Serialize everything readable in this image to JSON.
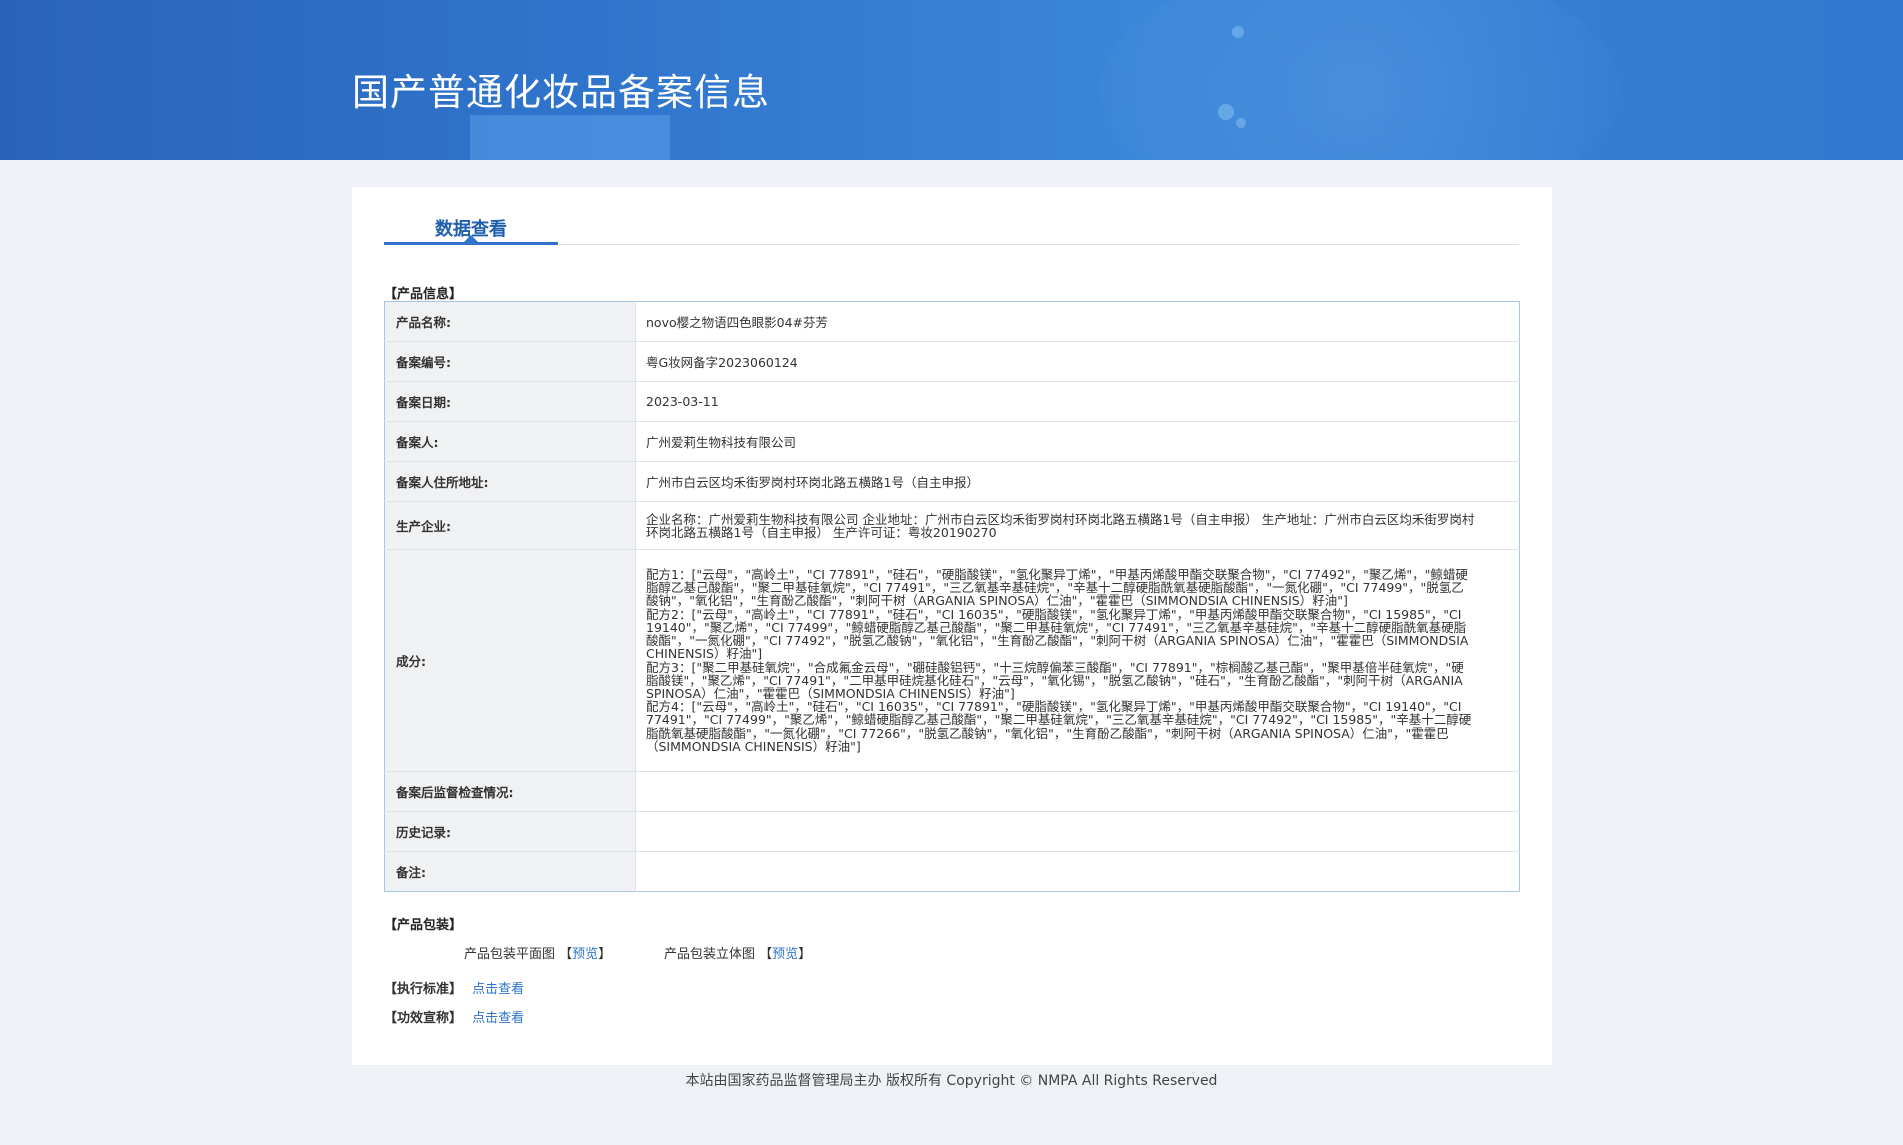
{
  "header": {
    "title": "国产普通化妆品备案信息"
  },
  "tab": {
    "label": "数据查看"
  },
  "sections": {
    "product_info": "【产品信息】",
    "product_package": "【产品包装】",
    "standard": "【执行标准】",
    "efficacy": "【功效宣称】"
  },
  "table": {
    "product_name": {
      "label": "产品名称:",
      "value": "novo樱之物语四色眼影04#芬芳"
    },
    "record_no": {
      "label": "备案编号:",
      "value": "粤G妆网备字2023060124"
    },
    "record_date": {
      "label": "备案日期:",
      "value": "2023-03-11"
    },
    "registrant": {
      "label": "备案人:",
      "value": "广州爱莉生物科技有限公司"
    },
    "registrant_address": {
      "label": "备案人住所地址:",
      "value": "广州市白云区均禾街罗岗村环岗北路五横路1号（自主申报）"
    },
    "manufacturer": {
      "label": "生产企业:",
      "value": "企业名称：广州爱莉生物科技有限公司 企业地址：广州市白云区均禾街罗岗村环岗北路五横路1号（自主申报） 生产地址：广州市白云区均禾街罗岗村环岗北路五横路1号（自主申报） 生产许可证：粤妆20190270"
    },
    "ingredients": {
      "label": "成分:",
      "value": "配方1：[\"云母\"，\"高岭土\"，\"CI 77891\"，\"硅石\"，\"硬脂酸镁\"，\"氢化聚异丁烯\"，\"甲基丙烯酸甲酯交联聚合物\"，\"CI 77492\"，\"聚乙烯\"，\"鲸蜡硬脂醇乙基己酸酯\"，\"聚二甲基硅氧烷\"，\"CI 77491\"，\"三乙氧基辛基硅烷\"，\"辛基十二醇硬脂酰氧基硬脂酸酯\"，\"一氮化硼\"，\"CI 77499\"，\"脱氢乙酸钠\"，\"氧化铝\"，\"生育酚乙酸酯\"，\"刺阿干树（ARGANIA SPINOSA）仁油\"，\"霍霍巴（SIMMONDSIA CHINENSIS）籽油\"]\n配方2：[\"云母\"，\"高岭土\"，\"CI 77891\"，\"硅石\"，\"CI 16035\"，\"硬脂酸镁\"，\"氢化聚异丁烯\"，\"甲基丙烯酸甲酯交联聚合物\"，\"CI 15985\"，\"CI 19140\"，\"聚乙烯\"，\"CI 77499\"，\"鲸蜡硬脂醇乙基己酸酯\"，\"聚二甲基硅氧烷\"，\"CI 77491\"，\"三乙氧基辛基硅烷\"，\"辛基十二醇硬脂酰氧基硬脂酸酯\"，\"一氮化硼\"，\"CI 77492\"，\"脱氢乙酸钠\"，\"氧化铝\"，\"生育酚乙酸酯\"，\"刺阿干树（ARGANIA SPINOSA）仁油\"，\"霍霍巴（SIMMONDSIA CHINENSIS）籽油\"]\n配方3：[\"聚二甲基硅氧烷\"，\"合成氟金云母\"，\"硼硅酸铝钙\"，\"十三烷醇偏苯三酸酯\"，\"CI 77891\"，\"棕榈酸乙基己酯\"，\"聚甲基倍半硅氧烷\"，\"硬脂酸镁\"，\"聚乙烯\"，\"CI 77491\"，\"二甲基甲硅烷基化硅石\"，\"云母\"，\"氧化锡\"，\"脱氢乙酸钠\"，\"硅石\"，\"生育酚乙酸酯\"，\"刺阿干树（ARGANIA SPINOSA）仁油\"，\"霍霍巴（SIMMONDSIA CHINENSIS）籽油\"]\n配方4：[\"云母\"，\"高岭土\"，\"硅石\"，\"CI 16035\"，\"CI 77891\"，\"硬脂酸镁\"，\"氢化聚异丁烯\"，\"甲基丙烯酸甲酯交联聚合物\"，\"CI 19140\"，\"CI 77491\"，\"CI 77499\"，\"聚乙烯\"，\"鲸蜡硬脂醇乙基己酸酯\"，\"聚二甲基硅氧烷\"，\"三乙氧基辛基硅烷\"，\"CI 77492\"，\"CI 15985\"，\"辛基十二醇硬脂酰氧基硬脂酸酯\"，\"一氮化硼\"，\"CI 77266\"，\"脱氢乙酸钠\"，\"氧化铝\"，\"生育酚乙酸酯\"，\"刺阿干树（ARGANIA SPINOSA）仁油\"，\"霍霍巴（SIMMONDSIA CHINENSIS）籽油\"]"
    },
    "post_inspection": {
      "label": "备案后监督检查情况:",
      "value": ""
    },
    "history": {
      "label": "历史记录:",
      "value": ""
    },
    "remarks": {
      "label": "备注:",
      "value": ""
    }
  },
  "package": {
    "flat_label": "产品包装平面图",
    "solid_label": "产品包装立体图",
    "bracket_open": "【",
    "bracket_close": "】",
    "preview": "预览"
  },
  "links": {
    "view": "点击查看"
  },
  "footer": {
    "text": "本站由国家药品监督管理局主办 版权所有 Copyright © NMPA All Rights Reserved"
  },
  "colors": {
    "banner": "#2f74cc",
    "accent": "#2f74c8",
    "label_bg": "#f0f1f3",
    "table_border": "#a9c6e6"
  }
}
